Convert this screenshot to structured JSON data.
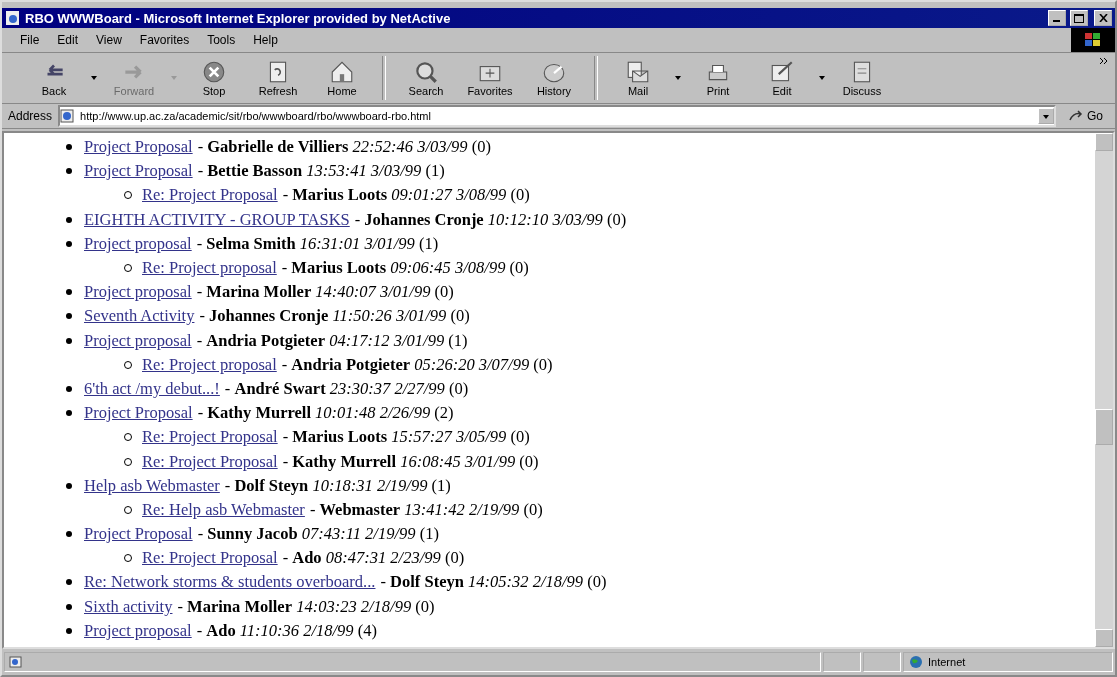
{
  "window": {
    "title": "RBO WWWBoard - Microsoft Internet Explorer provided by NetActive"
  },
  "menu": [
    "File",
    "Edit",
    "View",
    "Favorites",
    "Tools",
    "Help"
  ],
  "toolbar": {
    "groups": [
      {
        "buttons": [
          {
            "kind": "back",
            "label": "Back",
            "disabled": false,
            "dropdown": true
          },
          {
            "kind": "forward",
            "label": "Forward",
            "disabled": true,
            "dropdown": true
          },
          {
            "kind": "stop",
            "label": "Stop",
            "disabled": false,
            "dropdown": false
          },
          {
            "kind": "refresh",
            "label": "Refresh",
            "disabled": false,
            "dropdown": false
          },
          {
            "kind": "home",
            "label": "Home",
            "disabled": false,
            "dropdown": false
          }
        ]
      },
      {
        "buttons": [
          {
            "kind": "search",
            "label": "Search",
            "disabled": false,
            "dropdown": false
          },
          {
            "kind": "favorites",
            "label": "Favorites",
            "disabled": false,
            "dropdown": false
          },
          {
            "kind": "history",
            "label": "History",
            "disabled": false,
            "dropdown": false
          }
        ]
      },
      {
        "buttons": [
          {
            "kind": "mail",
            "label": "Mail",
            "disabled": false,
            "dropdown": true
          },
          {
            "kind": "print",
            "label": "Print",
            "disabled": false,
            "dropdown": false
          },
          {
            "kind": "edit",
            "label": "Edit",
            "disabled": false,
            "dropdown": true
          },
          {
            "kind": "discuss",
            "label": "Discuss",
            "disabled": false,
            "dropdown": false
          }
        ]
      }
    ]
  },
  "address": {
    "label": "Address",
    "value": "http://www.up.ac.za/academic/sit/rbo/wwwboard/rbo/wwwboard-rbo.html",
    "go": "Go"
  },
  "posts": [
    {
      "subject": "Project Proposal",
      "meta": "- **Gabrielle de Villiers** *22:52:46 3/03/99* (0)"
    },
    {
      "subject": "Project Proposal",
      "meta": "- **Bettie Basson** *13:53:41 3/03/99* (1)",
      "children": [
        {
          "subject": "Re: Project Proposal",
          "meta": "- **Marius Loots** *09:01:27 3/08/99* (0)"
        }
      ]
    },
    {
      "subject": "EIGHTH ACTIVITY - GROUP TASKS",
      "meta": "- **Johannes Cronje** *10:12:10 3/03/99* (0)"
    },
    {
      "subject": "Project proposal",
      "meta": "- **Selma Smith** *16:31:01 3/01/99* (1)",
      "children": [
        {
          "subject": "Re: Project proposal",
          "meta": "- **Marius Loots** *09:06:45 3/08/99* (0)"
        }
      ]
    },
    {
      "subject": "Project proposal",
      "meta": "- **Marina Moller** *14:40:07 3/01/99* (0)"
    },
    {
      "subject": "Seventh Activity",
      "meta": "- **Johannes Cronje** *11:50:26 3/01/99* (0)"
    },
    {
      "subject": "Project proposal",
      "meta": "- **Andria Potgieter** *04:17:12 3/01/99* (1)",
      "children": [
        {
          "subject": "Re: Project proposal",
          "meta": "- **Andria Potgieter** *05:26:20 3/07/99* (0)"
        }
      ]
    },
    {
      "subject": "6'th act /my debut...!",
      "meta": "- **André Swart** *23:30:37 2/27/99* (0)"
    },
    {
      "subject": "Project Proposal",
      "meta": "- **Kathy Murrell** *10:01:48 2/26/99* (2)",
      "children": [
        {
          "subject": "Re: Project Proposal",
          "meta": "- **Marius Loots** *15:57:27 3/05/99* (0)"
        },
        {
          "subject": "Re: Project Proposal",
          "meta": "- **Kathy Murrell** *16:08:45 3/01/99* (0)"
        }
      ]
    },
    {
      "subject": "Help asb Webmaster",
      "meta": "- **Dolf Steyn** *10:18:31 2/19/99* (1)",
      "children": [
        {
          "subject": "Re: Help asb Webmaster",
          "meta": "- **Webmaster** *13:41:42 2/19/99* (0)"
        }
      ]
    },
    {
      "subject": "Project Proposal",
      "meta": "- **Sunny Jacob** *07:43:11 2/19/99* (1)",
      "children": [
        {
          "subject": "Re: Project Proposal",
          "meta": "- **Ado** *08:47:31 2/23/99* (0)"
        }
      ]
    },
    {
      "subject": "Re: Network storms & students overboard...",
      "meta": "- **Dolf Steyn** *14:05:32 2/18/99* (0)"
    },
    {
      "subject": "Sixth activity",
      "meta": "- **Marina Moller** *14:03:23 2/18/99* (0)"
    },
    {
      "subject": "Project proposal",
      "meta": "- **Ado** *11:10:36 2/18/99* (4)"
    }
  ],
  "status_bar": {
    "zone": "Internet"
  }
}
